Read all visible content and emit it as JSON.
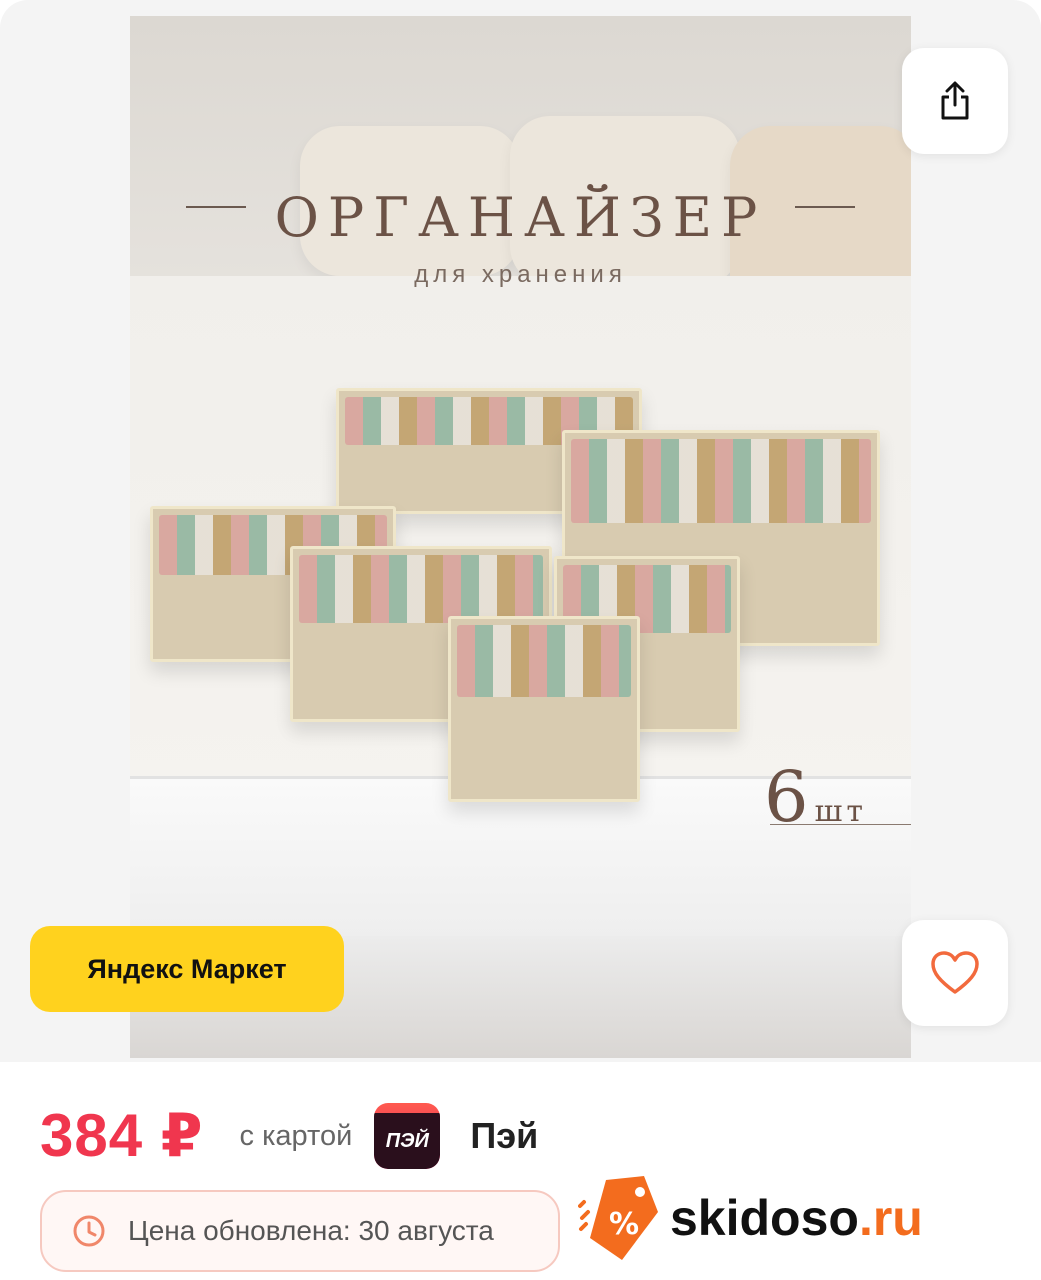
{
  "product": {
    "image": {
      "title": "ОРГАНАЙЗЕР",
      "subtitle": "для хранения",
      "quantity_number": "6",
      "quantity_unit": "шт"
    },
    "store_badge": "Яндекс Маркет",
    "actions": {
      "share_icon": "share-icon",
      "favorite_icon": "heart-icon"
    }
  },
  "pricing": {
    "price": "384 ₽",
    "card_text": "с картой",
    "pay_logo_text": "ПЭЙ",
    "pay_name": "Пэй",
    "updated_text": "Цена обновлена: 30 августа"
  },
  "watermark": {
    "name": "skidoso",
    "tld": ".ru",
    "logo_symbol": "%"
  },
  "colors": {
    "price": "#f0364e",
    "store_badge": "#ffd21e",
    "heart": "#f26a3d",
    "watermark_accent": "#f36c1e"
  }
}
